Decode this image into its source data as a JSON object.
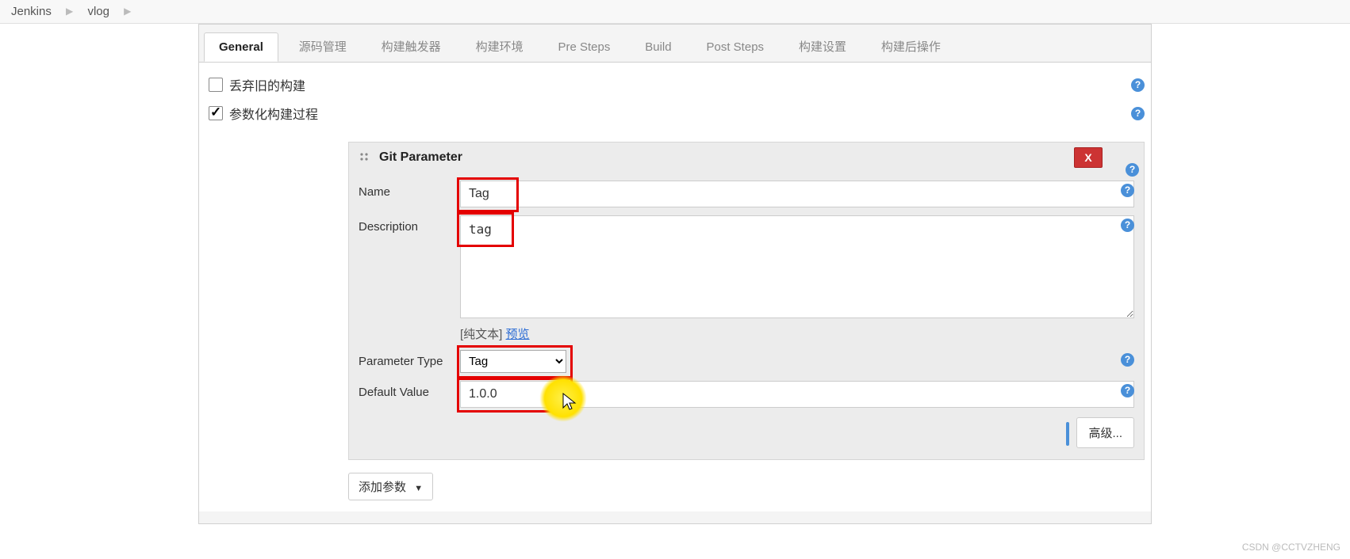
{
  "breadcrumb": {
    "items": [
      "Jenkins",
      "vlog"
    ]
  },
  "tabs": [
    {
      "label": "General",
      "active": true
    },
    {
      "label": "源码管理",
      "active": false
    },
    {
      "label": "构建触发器",
      "active": false
    },
    {
      "label": "构建环境",
      "active": false
    },
    {
      "label": "Pre Steps",
      "active": false
    },
    {
      "label": "Build",
      "active": false
    },
    {
      "label": "Post Steps",
      "active": false
    },
    {
      "label": "构建设置",
      "active": false
    },
    {
      "label": "构建后操作",
      "active": false
    }
  ],
  "options": {
    "discard_old": {
      "label": "丢弃旧的构建",
      "checked": false
    },
    "parameterized": {
      "label": "参数化构建过程",
      "checked": true
    }
  },
  "parameter": {
    "title": "Git Parameter",
    "delete_label": "X",
    "name_label": "Name",
    "name_value": "Tag",
    "description_label": "Description",
    "description_value": "tag",
    "desc_hint_prefix": "[纯文本] ",
    "desc_hint_link": "预览",
    "type_label": "Parameter Type",
    "type_value": "Tag",
    "default_label": "Default Value",
    "default_value": "1.0.0",
    "advanced_label": "高级..."
  },
  "add_param_label": "添加参数",
  "watermark": "CSDN @CCTVZHENG",
  "colors": {
    "accent": "#4a90d9",
    "danger": "#cc3333",
    "annotation": "#e40000",
    "highlight": "#ffe100"
  }
}
